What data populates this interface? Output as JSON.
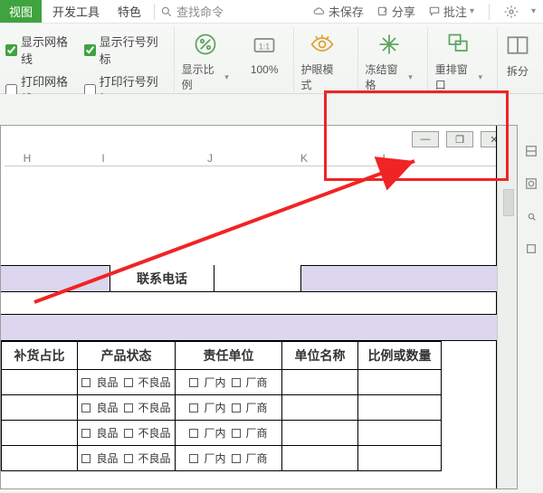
{
  "menu": {
    "active_tab": "视图",
    "tabs": [
      "开发工具",
      "特色"
    ],
    "search_placeholder": "查找命令",
    "right": {
      "unsaved": "未保存",
      "share": "分享",
      "annotate": "批注"
    }
  },
  "ribbon": {
    "checks": {
      "show_gridlines": "显示网格线",
      "show_rowcol_labels": "显示行号列标",
      "print_gridlines": "打印网格线",
      "print_rowcol_labels": "打印行号列标"
    },
    "groups": {
      "zoom_ratio": "显示比例",
      "zoom_value": "100%",
      "eye_mode": "护眼模式",
      "freeze_panes": "冻结窗格",
      "rearrange_windows": "重排窗口",
      "split": "拆分"
    }
  },
  "colheaders": [
    "H",
    "I",
    "J",
    "K",
    "L"
  ],
  "contact_label": "联系电话",
  "table": {
    "headers": [
      "补货占比",
      "产品状态",
      "责任单位",
      "单位名称",
      "比例或数量"
    ],
    "status_good": "良品",
    "status_bad": "不良品",
    "loc_in": "厂内",
    "loc_vendor": "厂商"
  },
  "window_controls": {
    "min": "—",
    "restore": "❐",
    "close": "✕"
  }
}
